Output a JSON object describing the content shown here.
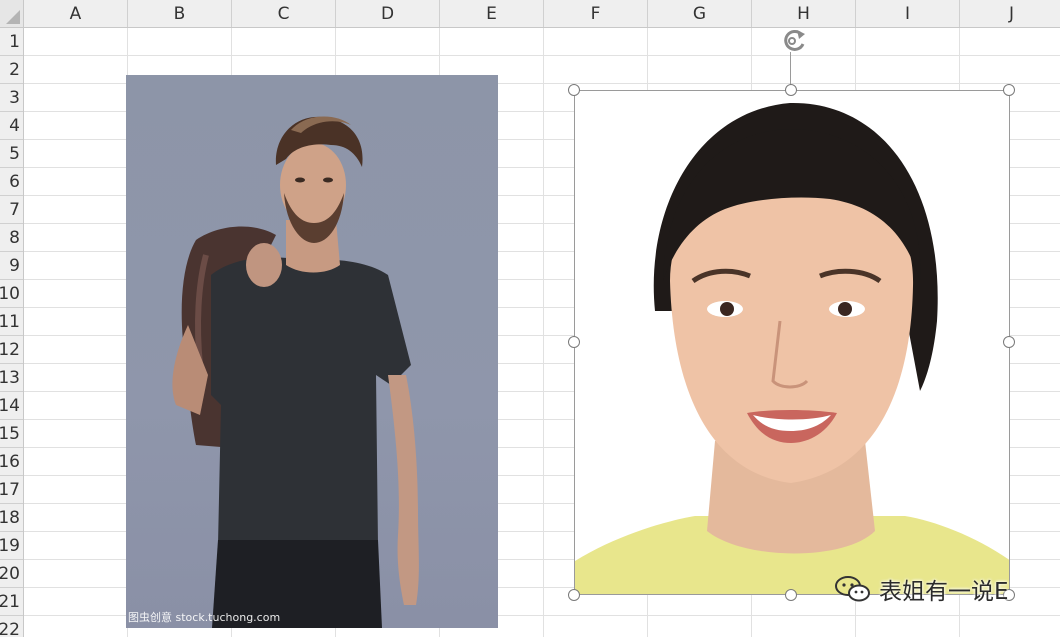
{
  "sheet": {
    "columns": [
      "A",
      "B",
      "C",
      "D",
      "E",
      "F",
      "G",
      "H",
      "I",
      "J"
    ],
    "rows": [
      "1",
      "2",
      "3",
      "4",
      "5",
      "6",
      "7",
      "8",
      "9",
      "10",
      "11",
      "12",
      "13",
      "14",
      "15",
      "16",
      "17",
      "18",
      "19",
      "20",
      "21",
      "22"
    ]
  },
  "picture1": {
    "watermark": "图虫创意 stock.tuchong.com"
  },
  "picture2": {
    "selected": true
  },
  "social": {
    "label": "表姐有一说E",
    "icon": "wechat-icon"
  },
  "colors": {
    "accent": "#7a7a7a",
    "photo_bg": "#8d95a8"
  }
}
